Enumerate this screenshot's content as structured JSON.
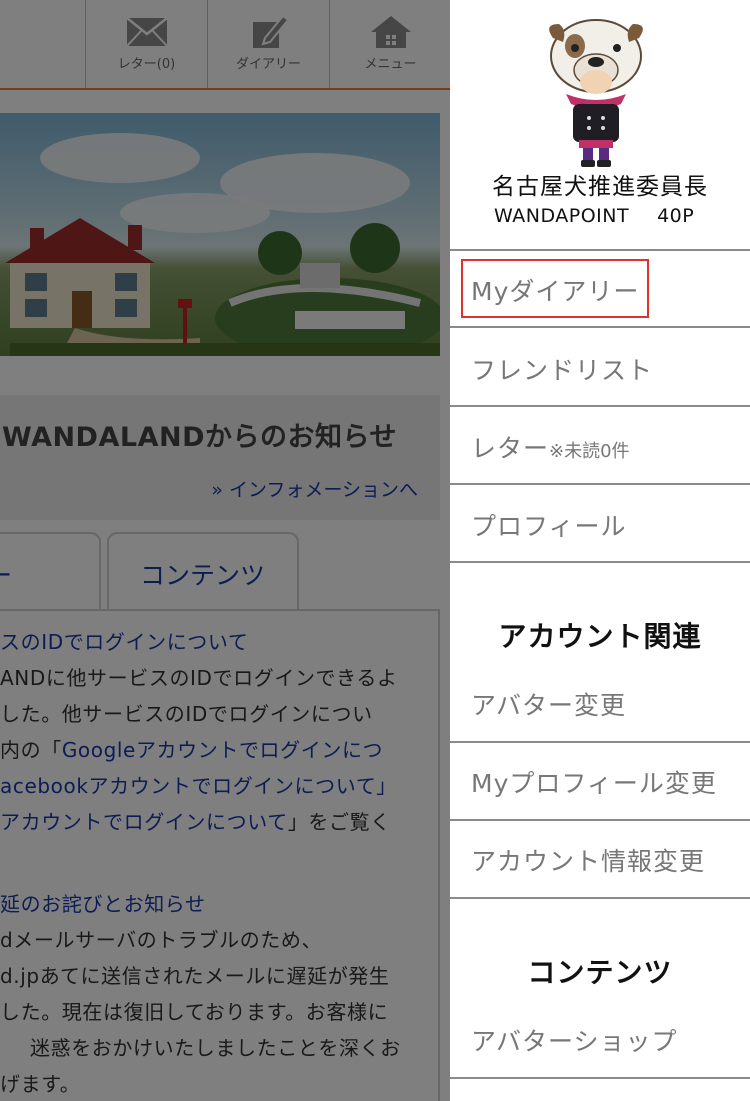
{
  "header": {
    "letter_label": "レター(0)",
    "diary_label": "ダイアリー",
    "menu_label": "メニュー"
  },
  "info": {
    "title": "WANDALANDからのお知らせ",
    "link": "» インフォメーションへ"
  },
  "tabs": [
    "ター",
    "コンテンツ"
  ],
  "news": {
    "item1_title": "スのIDでログインについて",
    "item1_lines": [
      "ANDに他サービスのIDでログインできるよ",
      "した。他サービスのIDでログインについ",
      "内の「",
      "Googleアカウントでログインにつ",
      "acebookアカウントでログインについて」",
      "アカウントでログインについて",
      "」をご覧く"
    ],
    "item2_title": "延のお詫びとお知らせ",
    "item2_lines": [
      "dメールサーバのトラブルのため、",
      "d.jpあてに送信されたメールに遅延が発生",
      "した。現在は復旧しております。お客様に",
      "迷惑をおかけいたしましたことを深くお",
      "げます。"
    ]
  },
  "user": {
    "name": "名古屋犬推進委員長",
    "points_label": "WANDAPOINT",
    "points_value": "40P"
  },
  "menu": {
    "items": [
      "Myダイアリー",
      "フレンドリスト",
      "レター",
      "プロフィール"
    ],
    "letter_note": "※未読0件",
    "section_account": "アカウント関連",
    "account_items": [
      "アバター変更",
      "Myプロフィール変更",
      "アカウント情報変更"
    ],
    "section_contents": "コンテンツ",
    "contents_items": [
      "アバターショップ"
    ]
  },
  "colors": {
    "accent_orange": "#ee7a2a",
    "link_blue": "#1a3aa8",
    "highlight_red": "#e0312e"
  }
}
